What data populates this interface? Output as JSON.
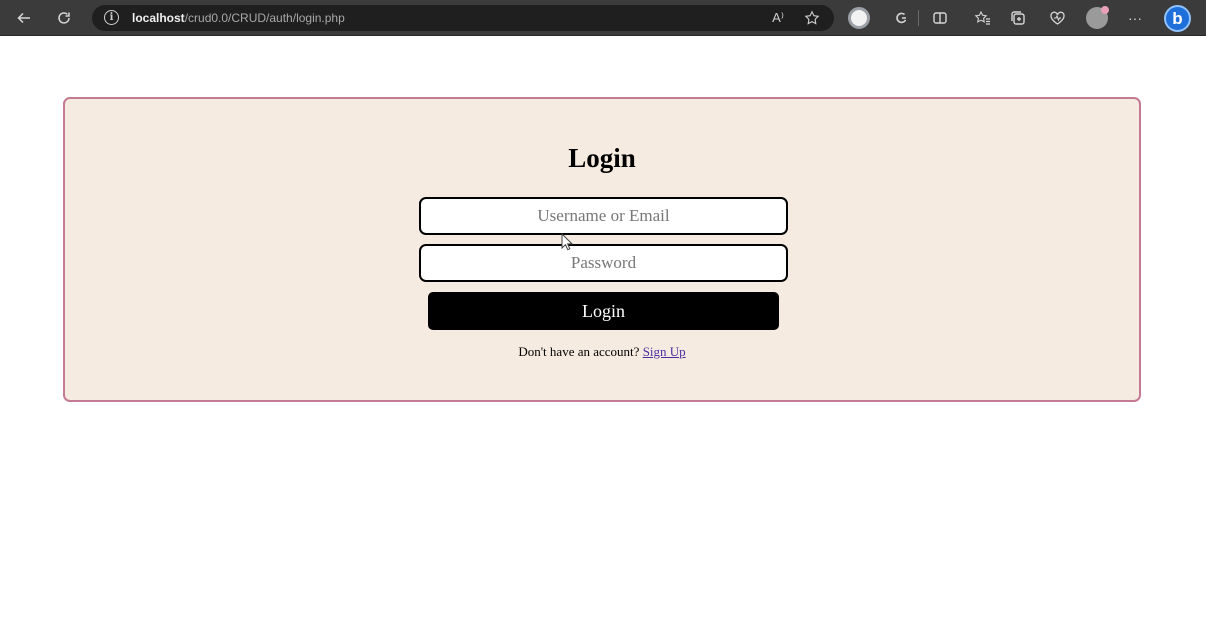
{
  "browser": {
    "address_host": "localhost",
    "address_path": "/crud0.0/CRUD/auth/login.php",
    "read_aloud_label": "A⁾",
    "more_label": "···",
    "bing_label": "b",
    "icons": [
      "back-icon",
      "refresh-icon",
      "info-icon",
      "read-aloud-icon",
      "favorite-star-icon",
      "browser-essentials-icon",
      "copilot-icon",
      "split-screen-icon",
      "favorites-icon",
      "collections-icon",
      "performance-icon",
      "profile-avatar-icon",
      "more-icon",
      "bing-icon"
    ]
  },
  "login": {
    "title": "Login",
    "username_placeholder": "Username or Email",
    "password_placeholder": "Password",
    "submit_label": "Login",
    "signup_prompt": "Don't have an account?",
    "signup_link": "Sign Up"
  },
  "colors": {
    "card_background": "#f5ebe0",
    "card_border": "#c57a94",
    "button_background": "#000000",
    "link": "#4b2fa0"
  }
}
